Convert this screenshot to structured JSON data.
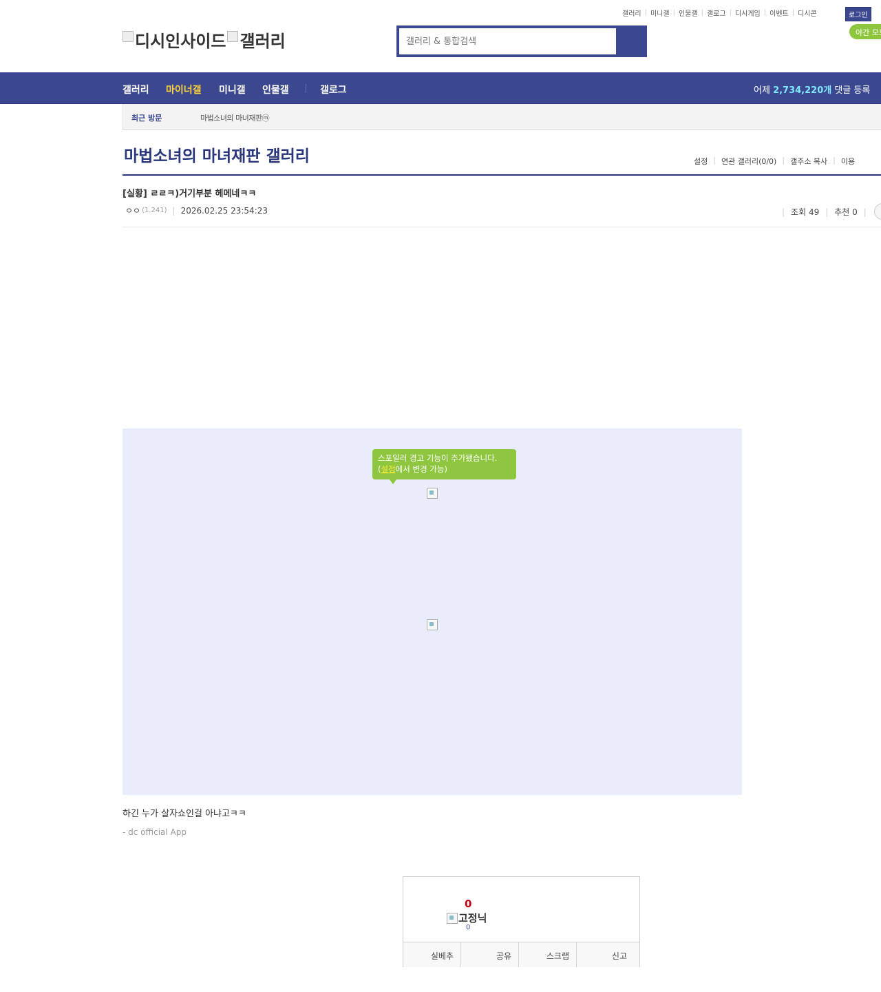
{
  "top_links": [
    "갤러리",
    "미니갤",
    "인물갤",
    "갤로그",
    "디시게임",
    "이벤트",
    "디시콘"
  ],
  "login_label": "로그인",
  "night_mode_label": "야간 모드",
  "logo": {
    "site": "디시인사이드",
    "section": "갤러리"
  },
  "search": {
    "placeholder": "갤러리 & 통합검색"
  },
  "nav": {
    "items": [
      "갤러리",
      "마이너갤",
      "미니갤",
      "인물갤",
      "갤로그"
    ],
    "active_index": 1,
    "stat_prefix": "어제 ",
    "stat_count": "2,734,220개",
    "stat_suffix": " 댓글 등록"
  },
  "recent": {
    "label": "최근 방문",
    "item": "마법소녀의 마녀재판ⓜ"
  },
  "gallery": {
    "title": "마법소녀의 마녀재판 갤러리",
    "links": [
      "설정",
      "연관 갤러리(0/0)",
      "갤주소 복사",
      "이용"
    ]
  },
  "post": {
    "title": "[실황] ㄹㄹㅋ)거기부분 헤메네ㅋㅋ",
    "author": "ㅇㅇ",
    "ip": "(1.241)",
    "date": "2026.02.25 23:54:23",
    "views_label": "조회 49",
    "recommend_label": "추천 0"
  },
  "tooltip": {
    "line1": "스포일러 경고 기능이 추가됐습니다.",
    "line2_pre": "(",
    "line2_link": "설정",
    "line2_post": "에서 변경 가능)"
  },
  "content": {
    "body": "하긴 누가 살자쇼인걸 아냐고ㅋㅋ",
    "signature": "- dc official App"
  },
  "recommend": {
    "count": "0",
    "fix_label": "고정닉",
    "fix_count": "0",
    "buttons": [
      "실베추",
      "공유",
      "스크랩",
      "신고"
    ]
  },
  "colors": {
    "brand": "#3b4890",
    "accent_yellow": "#ffd33a",
    "tooltip_green": "#8ec63f",
    "count_red": "#c0000f"
  }
}
